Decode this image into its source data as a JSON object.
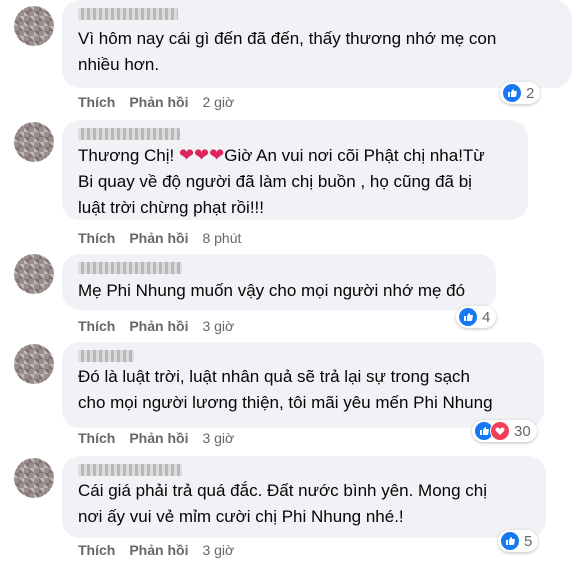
{
  "comments": [
    {
      "text": "Vì hôm nay cái gì đến đã đến, thấy thương nhớ mẹ con\nnhiều hơn.",
      "like_label": "Thích",
      "reply_label": "Phản hồi",
      "time": "2 giờ",
      "reaction_count": "2"
    },
    {
      "text_prefix": "Thương Chị! ",
      "hearts": "❤❤❤",
      "text_suffix": "Giờ An vui nơi cõi Phật chị nha!Từ\nBi quay về độ người đã làm chị buồn , họ cũng đã bị\nluật trời chừng phạt rồi!!!",
      "like_label": "Thích",
      "reply_label": "Phản hồi",
      "time": "8 phút"
    },
    {
      "text": "Mẹ Phi Nhung muốn vậy cho mọi người nhớ mẹ đó",
      "like_label": "Thích",
      "reply_label": "Phản hồi",
      "time": "3 giờ",
      "reaction_count": "4"
    },
    {
      "text": "Đó là luật trời, luật nhân quả sẽ trả lại sự trong sạch\ncho mọi người lương thiện, tôi mãi yêu mến Phi Nhung",
      "like_label": "Thích",
      "reply_label": "Phản hồi",
      "time": "3 giờ",
      "reaction_count": "30"
    },
    {
      "text": "Cái giá phải trả quá đắc. Đất nước bình yên. Mong chị\nnơi ấy vui vẻ mỉm cười chị Phi Nhung nhé.!",
      "like_label": "Thích",
      "reply_label": "Phản hồi",
      "time": "3 giờ",
      "reaction_count": "5"
    }
  ],
  "colors": {
    "bubble": "#f0f2f5",
    "like_blue": "#1877f2",
    "love_red": "#f33e58",
    "meta_gray": "#65676b"
  }
}
